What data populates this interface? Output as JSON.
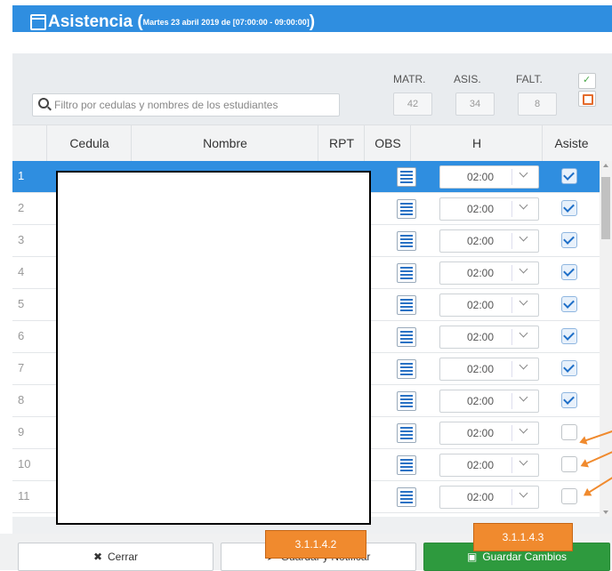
{
  "window": {
    "title": "Asistencia (",
    "subtitle": "Martes 23 abril 2019 de [07:00:00 - 09:00:00]",
    "title_close": ")"
  },
  "filter": {
    "placeholder": "Filtro por cedulas y nombres de los estudiantes",
    "stats": [
      {
        "label": "MATR.",
        "value": "42"
      },
      {
        "label": "ASIS.",
        "value": "34"
      },
      {
        "label": "FALT.",
        "value": "8"
      }
    ]
  },
  "table": {
    "headers": [
      "Cedula",
      "Nombre",
      "RPT",
      "OBS",
      "H",
      "Asiste"
    ],
    "rows": [
      {
        "n": "1",
        "h": "02:00",
        "asiste": true
      },
      {
        "n": "2",
        "h": "02:00",
        "asiste": true
      },
      {
        "n": "3",
        "h": "02:00",
        "asiste": true
      },
      {
        "n": "4",
        "h": "02:00",
        "asiste": true
      },
      {
        "n": "5",
        "h": "02:00",
        "asiste": true
      },
      {
        "n": "6",
        "h": "02:00",
        "asiste": true
      },
      {
        "n": "7",
        "h": "02:00",
        "asiste": true
      },
      {
        "n": "8",
        "h": "02:00",
        "asiste": true
      },
      {
        "n": "9",
        "h": "02:00",
        "asiste": false
      },
      {
        "n": "10",
        "h": "02:00",
        "asiste": false
      },
      {
        "n": "11",
        "h": "02:00",
        "asiste": false
      }
    ]
  },
  "footer": {
    "close_label": "Cerrar",
    "save_notify_label": "Guardar y Notificar",
    "save_label": "Guardar Cambios"
  },
  "annotations": {
    "tag1": "3.1.1.4.2",
    "tag2": "3.1.1.4.3"
  },
  "colors": {
    "accent": "#2f8ee0",
    "save_green": "#2e9a3e",
    "annotation_orange": "#f08a2e"
  }
}
